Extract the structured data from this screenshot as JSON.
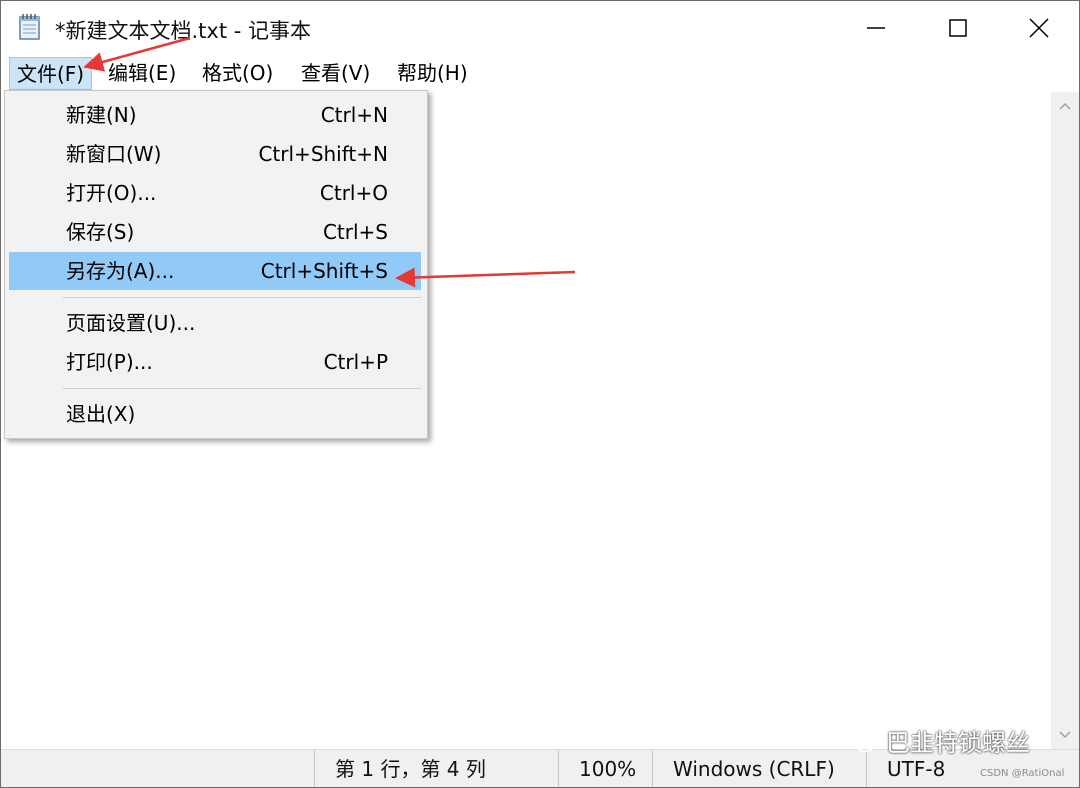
{
  "window": {
    "title": "*新建文本文档.txt - 记事本",
    "icon": "notepad-icon"
  },
  "title_buttons": [
    "minimize-icon",
    "maximize-icon",
    "close-icon"
  ],
  "menu": {
    "file": "文件(F)",
    "edit": "编辑(E)",
    "format": "格式(O)",
    "view": "查看(V)",
    "help": "帮助(H)"
  },
  "file_menu": {
    "new": {
      "label": "新建(N)",
      "shortcut": "Ctrl+N"
    },
    "new_window": {
      "label": "新窗口(W)",
      "shortcut": "Ctrl+Shift+N"
    },
    "open": {
      "label": "打开(O)...",
      "shortcut": "Ctrl+O"
    },
    "save": {
      "label": "保存(S)",
      "shortcut": "Ctrl+S"
    },
    "save_as": {
      "label": "另存为(A)...",
      "shortcut": "Ctrl+Shift+S",
      "highlighted": true
    },
    "page_setup": {
      "label": "页面设置(U)..."
    },
    "print": {
      "label": "打印(P)...",
      "shortcut": "Ctrl+P"
    },
    "exit": {
      "label": "退出(X)"
    }
  },
  "status": {
    "position": "第 1 行，第 4 列",
    "zoom": "100%",
    "line_ending": "Windows (CRLF)",
    "encoding": "UTF-8"
  },
  "watermarks": {
    "wechat": "巴韭特锁螺丝",
    "csdn": "CSDN @RatiOnal"
  },
  "colors": {
    "menu_active": "#cce4f7",
    "item_highlight": "#91c9f7",
    "arrow": "#e53935"
  }
}
